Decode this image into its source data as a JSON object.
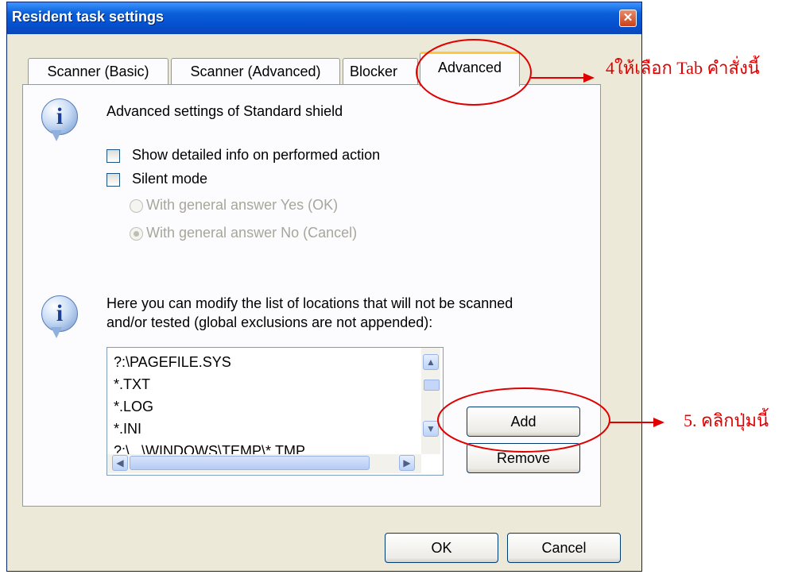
{
  "window": {
    "title": "Resident task settings",
    "close_glyph": "✕"
  },
  "tabs": [
    {
      "label": "Scanner (Basic)"
    },
    {
      "label": "Scanner (Advanced)"
    },
    {
      "label": "Blocker"
    },
    {
      "label": "Advanced",
      "active": true
    }
  ],
  "section1": {
    "heading": "Advanced settings of Standard shield",
    "show_detailed_label": "Show detailed info on performed action",
    "show_detailed_checked": false,
    "silent_mode_label": "Silent mode",
    "silent_mode_checked": false,
    "radio_yes_label": "With general answer Yes (OK)",
    "radio_no_label": "With general answer No (Cancel)",
    "radio_selected": "no",
    "radios_enabled": false
  },
  "section2": {
    "description_line1": "Here you can modify the list of locations that will not be scanned",
    "description_line2": "and/or tested (global exclusions are not appended):",
    "exclusions": [
      "?:\\PAGEFILE.SYS",
      "*.TXT",
      "*.LOG",
      "*.INI",
      "?:\\...\\WINDOWS\\TEMP\\*.TMP"
    ],
    "add_label": "Add",
    "remove_label": "Remove"
  },
  "footer": {
    "ok_label": "OK",
    "cancel_label": "Cancel"
  },
  "annotations": {
    "step4": "4ให้เลือก Tab คำสั่งนี้",
    "step5": "5. คลิกปุ่มนี้",
    "color": "#e00000"
  },
  "icons": {
    "info": "info-icon",
    "scroll_up": "▲",
    "scroll_down": "▼",
    "scroll_left": "◀",
    "scroll_right": "▶"
  }
}
